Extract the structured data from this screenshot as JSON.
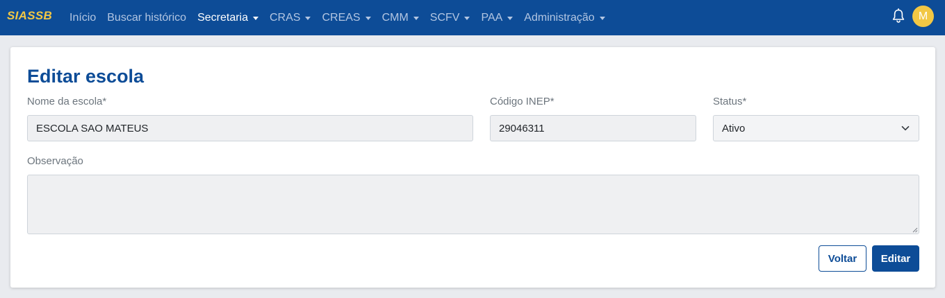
{
  "navbar": {
    "brand": "SIASSB",
    "items": [
      {
        "label": "Início",
        "dropdown": false,
        "active": false
      },
      {
        "label": "Buscar histórico",
        "dropdown": false,
        "active": false
      },
      {
        "label": "Secretaria",
        "dropdown": true,
        "active": true
      },
      {
        "label": "CRAS",
        "dropdown": true,
        "active": false
      },
      {
        "label": "CREAS",
        "dropdown": true,
        "active": false
      },
      {
        "label": "CMM",
        "dropdown": true,
        "active": false
      },
      {
        "label": "SCFV",
        "dropdown": true,
        "active": false
      },
      {
        "label": "PAA",
        "dropdown": true,
        "active": false
      },
      {
        "label": "Administração",
        "dropdown": true,
        "active": false
      }
    ],
    "notification_icon": "bell-icon",
    "avatar_initial": "M"
  },
  "form": {
    "title": "Editar escola",
    "school_name_label": "Nome da escola*",
    "school_name_value": "ESCOLA SAO MATEUS",
    "inep_label": "Código INEP*",
    "inep_value": "29046311",
    "status_label": "Status*",
    "status_value": "Ativo",
    "notes_label": "Observação",
    "notes_value": "",
    "back_button": "Voltar",
    "submit_button": "Editar"
  },
  "colors": {
    "navbar_bg": "#0d4c97",
    "brand": "#f2c744",
    "primary": "#0d4c97",
    "avatar_bg": "#f2c744"
  }
}
